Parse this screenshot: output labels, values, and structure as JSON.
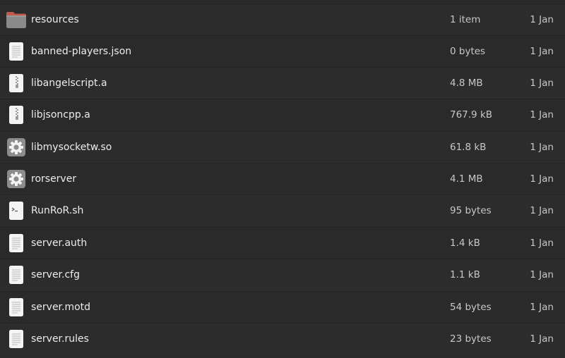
{
  "files": [
    {
      "name": "resources",
      "size": "1 item",
      "date": "1 Jan",
      "icon": "folder-icon"
    },
    {
      "name": "banned-players.json",
      "size": "0 bytes",
      "date": "1 Jan",
      "icon": "text-file-icon"
    },
    {
      "name": "libangelscript.a",
      "size": "4.8 MB",
      "date": "1 Jan",
      "icon": "archive-file-icon"
    },
    {
      "name": "libjsoncpp.a",
      "size": "767.9 kB",
      "date": "1 Jan",
      "icon": "archive-file-icon"
    },
    {
      "name": "libmysocketw.so",
      "size": "61.8 kB",
      "date": "1 Jan",
      "icon": "gear-icon"
    },
    {
      "name": "rorserver",
      "size": "4.1 MB",
      "date": "1 Jan",
      "icon": "gear-icon"
    },
    {
      "name": "RunRoR.sh",
      "size": "95 bytes",
      "date": "1 Jan",
      "icon": "script-file-icon"
    },
    {
      "name": "server.auth",
      "size": "1.4 kB",
      "date": "1 Jan",
      "icon": "text-file-icon"
    },
    {
      "name": "server.cfg",
      "size": "1.1 kB",
      "date": "1 Jan",
      "icon": "text-file-icon"
    },
    {
      "name": "server.motd",
      "size": "54 bytes",
      "date": "1 Jan",
      "icon": "text-file-icon"
    },
    {
      "name": "server.rules",
      "size": "23 bytes",
      "date": "1 Jan",
      "icon": "text-file-icon"
    }
  ],
  "colors": {
    "background": "#2a2a2a",
    "row_alt": "#2c2c2c",
    "text": "#ececec",
    "muted_text": "#c8c8c8",
    "folder": "#8a8a8a",
    "folder_tab": "#c25b4e",
    "gear_bg": "#8c8c8c"
  }
}
